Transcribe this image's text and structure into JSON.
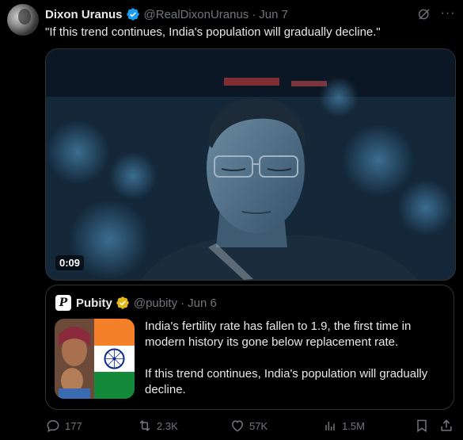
{
  "tweet": {
    "author_name": "Dixon Uranus",
    "handle": "@RealDixonUranus",
    "separator": "·",
    "date": "Jun 7",
    "text": "\"If this trend continues, India's population will gradually decline.\"",
    "video_duration": "0:09"
  },
  "quote": {
    "avatar_letter": "P",
    "author_name": "Pubity",
    "handle": "@pubity",
    "separator": "·",
    "date": "Jun 6",
    "paragraphs": [
      "India's fertility rate has fallen to 1.9, the first time in modern history its gone below replacement rate.",
      "If this trend continues, India's population will gradually decline."
    ]
  },
  "actions": {
    "replies": "177",
    "reposts": "2.3K",
    "likes": "57K",
    "views": "1.5M"
  },
  "colors": {
    "background": "#000000",
    "text": "#e7e9ea",
    "muted": "#71767b",
    "verified_blue": "#1d9bf0",
    "verified_gold": "#e2b719",
    "border": "#2f3336"
  }
}
